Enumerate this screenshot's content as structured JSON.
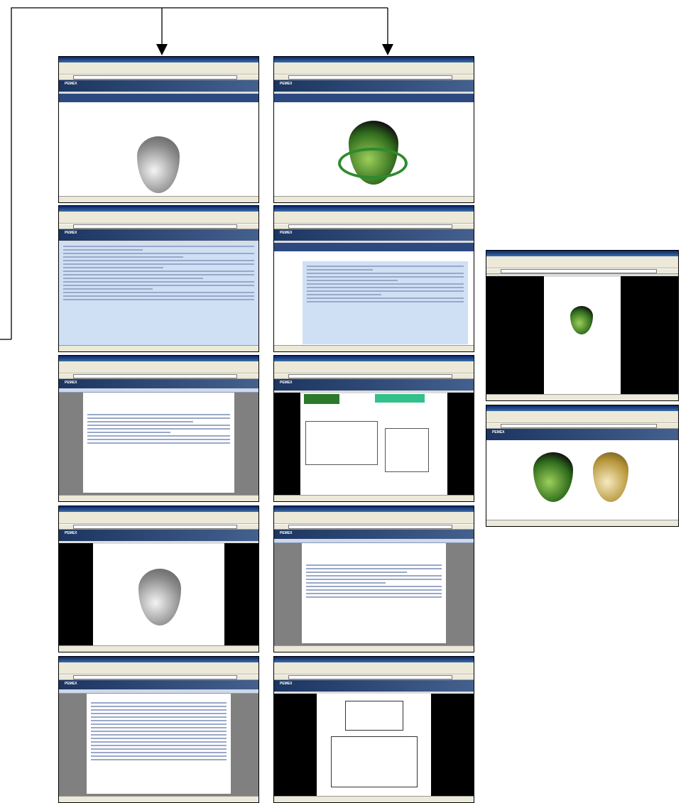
{
  "shots": [
    {
      "id": "s1",
      "window_title": "",
      "banner": "PEMEX",
      "page_heading": "",
      "kind": "silver-logo"
    },
    {
      "id": "s2",
      "window_title": "",
      "banner": "PEMEX",
      "page_heading": "",
      "kind": "green-logo"
    },
    {
      "id": "s3",
      "window_title": "",
      "banner": "PEMEX",
      "page_heading": "",
      "kind": "committee-list"
    },
    {
      "id": "s4",
      "window_title": "",
      "banner": "PEMEX",
      "page_heading": "",
      "kind": "committee-list-2"
    },
    {
      "id": "s5",
      "window_title": "",
      "banner": "PEMEX",
      "page_heading": "",
      "kind": "document"
    },
    {
      "id": "s6",
      "window_title": "",
      "banner": "PEMEX",
      "page_heading": "",
      "kind": "form"
    },
    {
      "id": "s7",
      "window_title": "",
      "banner": "PEMEX",
      "page_heading": "",
      "kind": "silver-logo-dark"
    },
    {
      "id": "s8",
      "window_title": "",
      "banner": "PEMEX",
      "page_heading": "",
      "kind": "document-2"
    },
    {
      "id": "s9",
      "window_title": "",
      "banner": "PEMEX",
      "page_heading": "",
      "kind": "program"
    },
    {
      "id": "s10",
      "window_title": "",
      "banner": "PEMEX",
      "page_heading": "",
      "kind": "layout-diagram"
    },
    {
      "id": "s11",
      "window_title": "",
      "banner": "",
      "page_heading": "",
      "kind": "small-green-logo"
    },
    {
      "id": "s12",
      "window_title": "",
      "banner": "PEMEX",
      "page_heading": "",
      "kind": "two-logos"
    }
  ],
  "colors": {
    "window_frame": "#0a246a",
    "banner": "#1c3561",
    "connector": "#000000",
    "green_logo": "#2f6b1c",
    "silver_logo": "#8a8a8a"
  }
}
